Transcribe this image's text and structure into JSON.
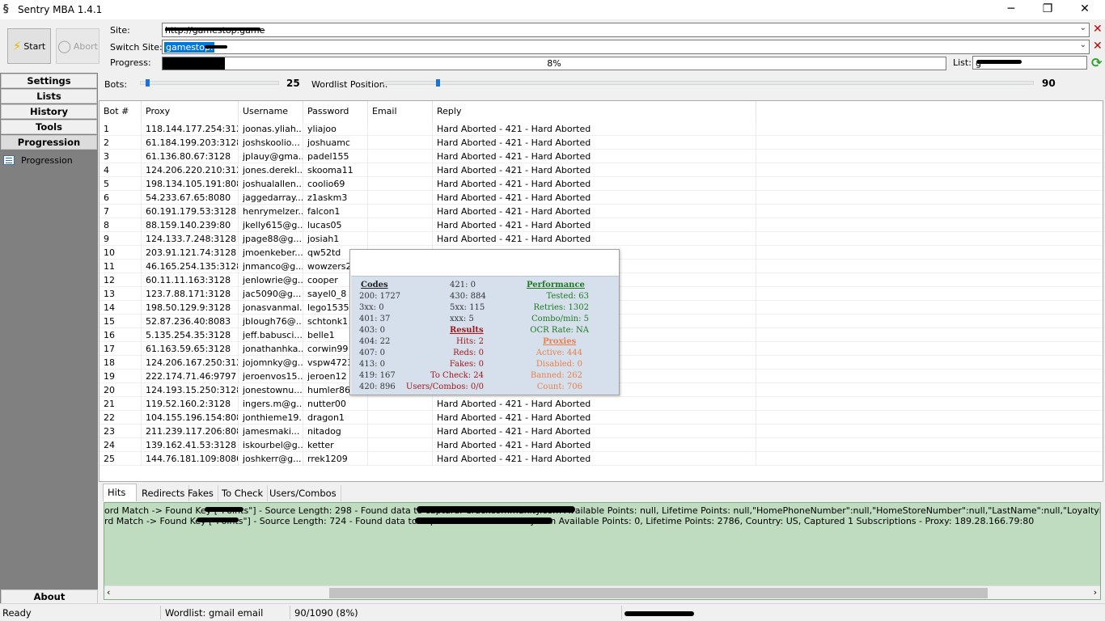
{
  "window": {
    "title": "Sentry MBA 1.4.1",
    "minimize_glyph": "─",
    "maximize_glyph": "❐",
    "close_glyph": "✕"
  },
  "toolbar": {
    "start_label": "Start",
    "abort_label": "Abort",
    "site_label": "Site:",
    "site_value": "http://gamestop.game",
    "switch_site_label": "Switch Site:",
    "switch_site_value": "gamestop.",
    "progress_label": "Progress:",
    "progress_text": "8%",
    "progress_fraction": 0.08,
    "list_label": "List:",
    "list_value": "g"
  },
  "sidebar": {
    "items": [
      {
        "label": "Settings"
      },
      {
        "label": "Lists"
      },
      {
        "label": "History"
      },
      {
        "label": "Tools"
      },
      {
        "label": "Progression"
      }
    ],
    "subitem": "Progression",
    "about": "About"
  },
  "sliders": {
    "bots_label": "Bots:",
    "bots_value": "25",
    "wordlist_label": "Wordlist Position:",
    "wordlist_value": "90"
  },
  "table": {
    "columns": [
      "Bot #",
      "Proxy",
      "Username",
      "Password",
      "Email",
      "Reply"
    ],
    "rows": [
      [
        "1",
        "118.144.177.254:3128",
        "joonas.yliah...",
        "yliajoo",
        "",
        "Hard Aborted - 421 - Hard Aborted"
      ],
      [
        "2",
        "61.184.199.203:3128",
        "joshskoolio...",
        "joshuamc",
        "",
        "Hard Aborted - 421 - Hard Aborted"
      ],
      [
        "3",
        "61.136.80.67:3128",
        "jplauy@gma...",
        "padel155",
        "",
        "Hard Aborted - 421 - Hard Aborted"
      ],
      [
        "4",
        "124.206.220.210:3128",
        "jones.derekl...",
        "skooma11",
        "",
        "Hard Aborted - 421 - Hard Aborted"
      ],
      [
        "5",
        "198.134.105.191:8080",
        "joshualallen...",
        "coolio69",
        "",
        "Hard Aborted - 421 - Hard Aborted"
      ],
      [
        "6",
        "54.233.67.65:8080",
        "jaggedarray...",
        "z1askm3",
        "",
        "Hard Aborted - 421 - Hard Aborted"
      ],
      [
        "7",
        "60.191.179.53:3128",
        "henrymelzer...",
        "falcon1",
        "",
        "Hard Aborted - 421 - Hard Aborted"
      ],
      [
        "8",
        "88.159.140.239:80",
        "jkelly615@g...",
        "lucas05",
        "",
        "Hard Aborted - 421 - Hard Aborted"
      ],
      [
        "9",
        "124.133.7.248:3128",
        "jpage88@g...",
        "josiah1",
        "",
        "Hard Aborted - 421 - Hard Aborted"
      ],
      [
        "10",
        "203.91.121.74:3128",
        "jmoenkeber...",
        "qw52td",
        "",
        ""
      ],
      [
        "11",
        "46.165.254.135:3128",
        "jnmanco@g...",
        "wowzers2",
        "",
        ""
      ],
      [
        "12",
        "60.11.11.163:3128",
        "jenlowrie@g...",
        "cooper",
        "",
        ""
      ],
      [
        "13",
        "123.7.88.171:3128",
        "jac5090@g...",
        "sayel0_8",
        "",
        ""
      ],
      [
        "14",
        "198.50.129.9:3128",
        "jonasvanmal...",
        "lego1535",
        "",
        ""
      ],
      [
        "15",
        "52.87.236.40:8083",
        "jblough76@...",
        "schtonk1",
        "",
        ""
      ],
      [
        "16",
        "5.135.254.35:3128",
        "jeff.babusci...",
        "belle1",
        "",
        ""
      ],
      [
        "17",
        "61.163.59.65:3128",
        "jonathanhka...",
        "corwin99",
        "",
        ""
      ],
      [
        "18",
        "124.206.167.250:3128",
        "jojomnky@g...",
        "vspw4723",
        "",
        ""
      ],
      [
        "19",
        "222.174.71.46:9797",
        "jeroenvos15...",
        "jeroen12",
        "",
        ""
      ],
      [
        "20",
        "124.193.15.250:3128",
        "jonestownu...",
        "humler86",
        "",
        ""
      ],
      [
        "21",
        "119.52.160.2:3128",
        "ingers.m@g...",
        "nutter00",
        "",
        "Hard Aborted - 421 - Hard Aborted"
      ],
      [
        "22",
        "104.155.196.154:8080",
        "jonthieme19...",
        "dragon1",
        "",
        "Hard Aborted - 421 - Hard Aborted"
      ],
      [
        "23",
        "211.239.117.206:8080",
        "jamesmaki...",
        "nitadog",
        "",
        "Hard Aborted - 421 - Hard Aborted"
      ],
      [
        "24",
        "139.162.41.53:3128",
        "iskourbel@g...",
        "ketter",
        "",
        "Hard Aborted - 421 - Hard Aborted"
      ],
      [
        "25",
        "144.76.181.109:8080",
        "joshkerr@g...",
        "rrek1209",
        "",
        "Hard Aborted - 421 - Hard Aborted"
      ]
    ]
  },
  "popup": {
    "codes_header": "Codes",
    "codes": [
      "200: 1727",
      "3xx: 0",
      "401: 37",
      "403: 0",
      "404: 22",
      "407: 0",
      "413: 0",
      "419: 167",
      "420: 896"
    ],
    "codes2": [
      "421: 0",
      "430: 884",
      "5xx: 115",
      "xxx: 5"
    ],
    "results_header": "Results",
    "results": [
      "Hits: 2",
      "Reds: 0",
      "Fakes: 0",
      "To Check: 24",
      "Users/Combos: 0/0"
    ],
    "performance_header": "Performance",
    "performance": [
      "Tested: 63",
      "Retries: 1302",
      "Combo/min: 5",
      "OCR Rate: NA"
    ],
    "proxies_header": "Proxies",
    "proxies": [
      "Active: 444",
      "Disabled: 0",
      "Banned: 262",
      "Count: 706"
    ]
  },
  "log": {
    "tabs": [
      "Hits",
      "Redirects",
      "Fakes",
      "To Check",
      "Users/Combos"
    ],
    "lines": [
      "ord Match -> Found Key [\"Points\"] - Source Length: 298 - Found data to capture: Crackcommunity.com Available Points: null, Lifetime Points: null,\"HomePhoneNumber\":null,\"HomeStoreNumber\":null,\"LastName\":null,\"LoyaltyMembership\":null,\"MobilePhoneNur",
      "rd Match -> Found Key [\"Points\"] - Source Length: 724 - Found data to capture: Crackcommunity.com Available Points: 0, Lifetime Points: 2786, Country: US, Captured 1 Subscriptions - Proxy: 189.28.166.79:80"
    ]
  },
  "status": {
    "ready": "Ready",
    "wordlist": "Wordlist: gmail email",
    "position": "90/1090 (8%)"
  }
}
